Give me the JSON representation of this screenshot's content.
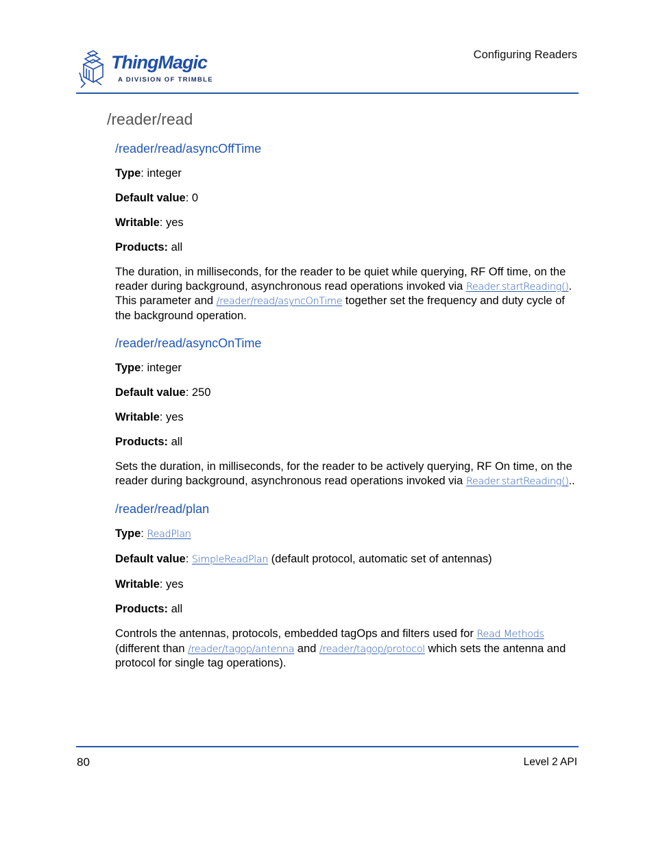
{
  "header": {
    "logo": {
      "brand": "ThingMagic",
      "tagline": "A DIVISION OF TRIMBLE",
      "icon": "thingmagic-cube-icon"
    },
    "chapter_title": "Configuring Readers"
  },
  "section_title": "/reader/read",
  "params": [
    {
      "name": "/reader/read/asyncOffTime",
      "type_label": "Type",
      "type_value": "integer",
      "default_label": "Default value",
      "default_value": "0",
      "writable_label": "Writable",
      "writable_value": "yes",
      "products_label": "Products:",
      "products_value": "all",
      "description": {
        "part1": "The duration, in milliseconds, for the reader to be quiet while querying, RF Off time, on the reader during background, asynchronous read operations invoked via ",
        "link1": "Reader.startReading()",
        "part2": ". This parameter and ",
        "link2": "/reader/read/asyncOnTime",
        "part3": " together set the frequency and duty cycle of the background operation."
      }
    },
    {
      "name": "/reader/read/asyncOnTime",
      "type_label": "Type",
      "type_value": "integer",
      "default_label": "Default value",
      "default_value": "250",
      "writable_label": "Writable",
      "writable_value": "yes",
      "products_label": "Products:",
      "products_value": "all",
      "description": {
        "part1": "Sets the duration, in milliseconds, for the reader to be actively querying, RF On time, on the reader during background, asynchronous read operations invoked via ",
        "link1": "Reader.startReading()",
        "part2": ".."
      }
    },
    {
      "name": "/reader/read/plan",
      "type_label": "Type",
      "type_link": "ReadPlan",
      "default_label": "Default value",
      "default_link": "SimpleReadPlan",
      "default_suffix": " (default protocol, automatic set of antennas)",
      "writable_label": "Writable",
      "writable_value": "yes",
      "products_label": "Products:",
      "products_value": "all",
      "description": {
        "part1": "Controls the antennas, protocols, embedded tagOps and filters used for ",
        "link1": "Read Methods",
        "part2": " (different than ",
        "link2": "/reader/tagop/antenna",
        "part3": " and ",
        "link3": "/reader/tagop/protocol",
        "part4": " which sets the antenna and protocol for single tag operations)."
      }
    }
  ],
  "footer": {
    "page_number": "80",
    "title": "Level 2 API"
  },
  "colors": {
    "accent_rule": "#2258a8",
    "heading_blue": "#1f55b5",
    "link_blue": "#2a5cb4",
    "section_gray": "#555555"
  }
}
